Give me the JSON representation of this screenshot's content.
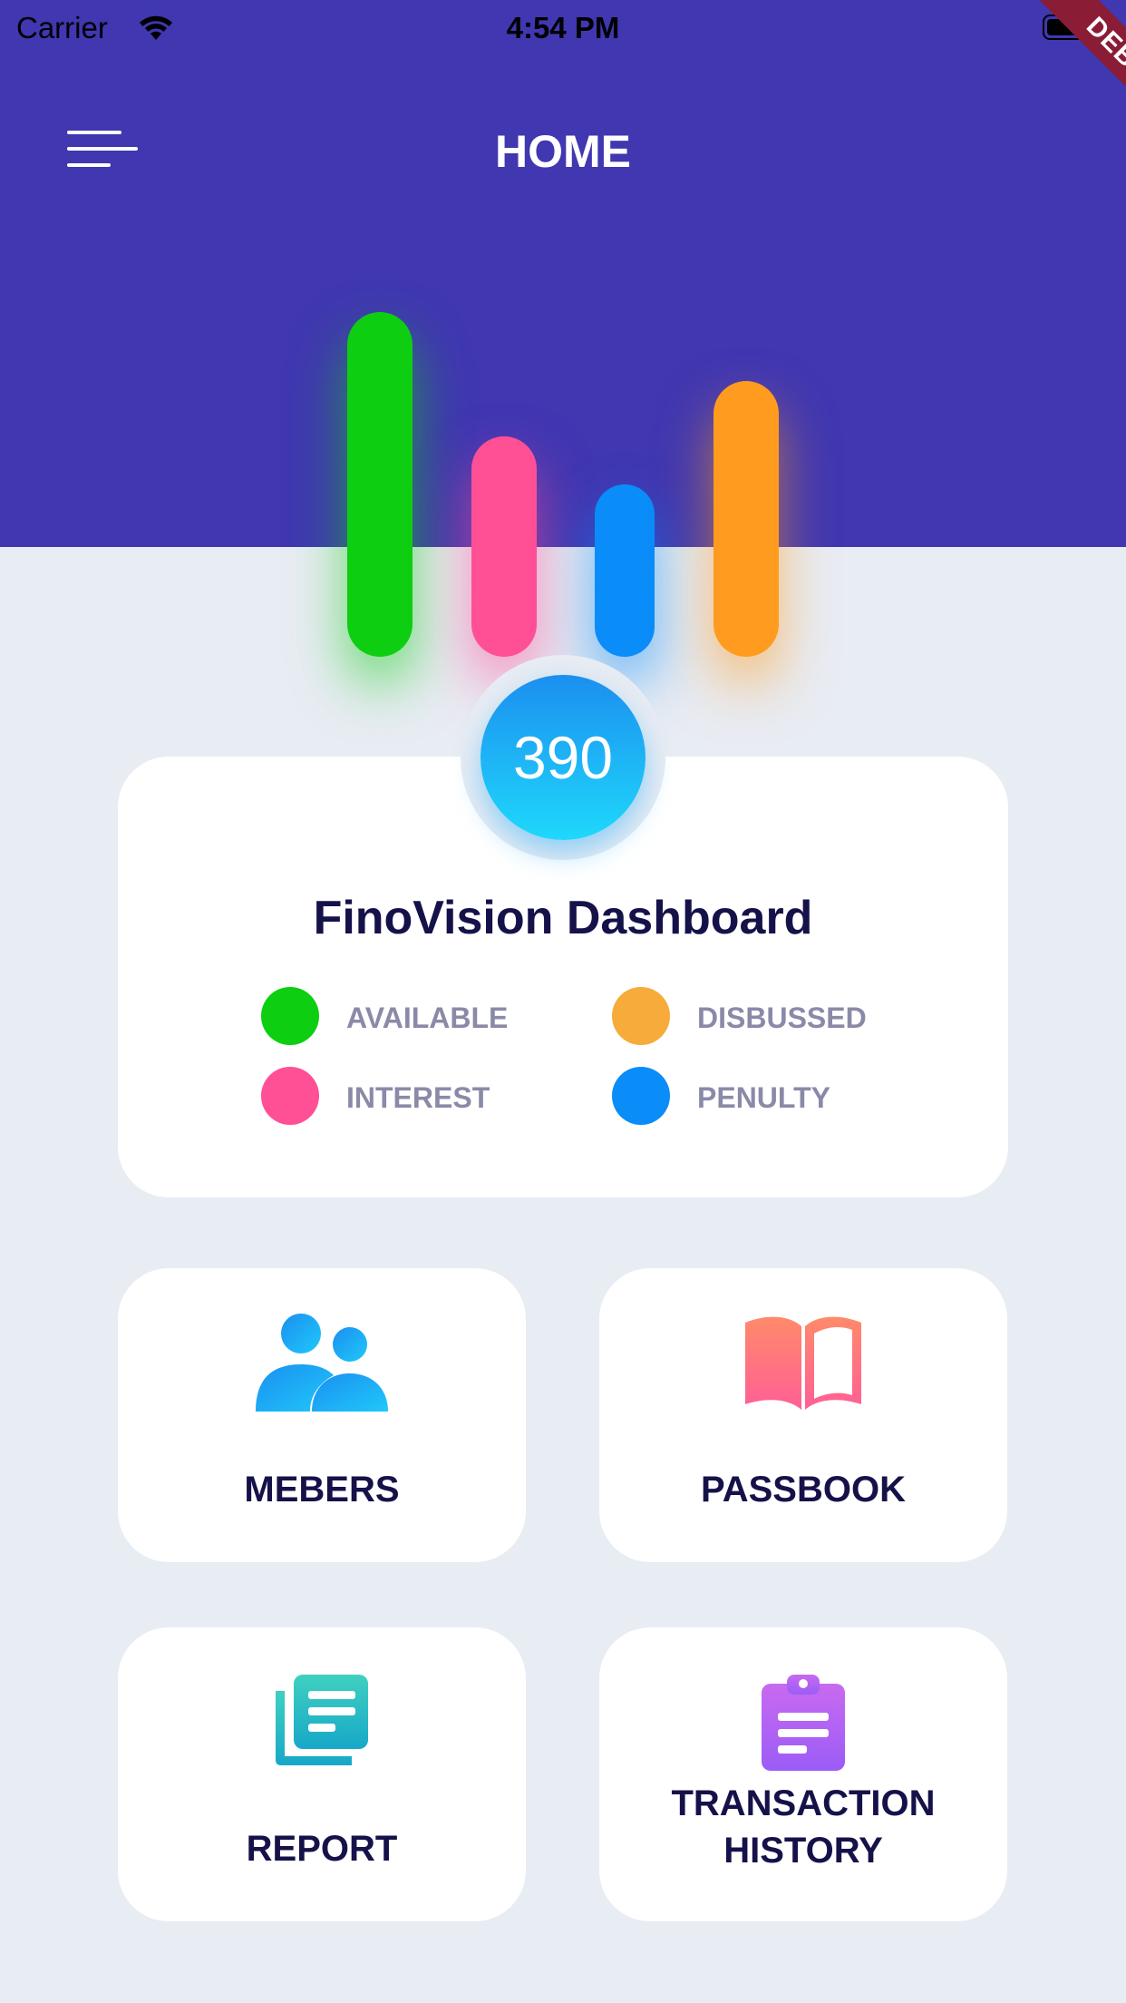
{
  "status_bar": {
    "carrier": "Carrier",
    "time": "4:54 PM",
    "icons": [
      "wifi-icon",
      "battery-icon"
    ]
  },
  "debug_banner": "DEBUG",
  "app_bar": {
    "title": "HOME",
    "menu_icon": "menu-icon"
  },
  "colors": {
    "header": "#4037b1",
    "background": "#e8ecf3",
    "available": "#0dce10",
    "interest": "#ff4f95",
    "penulty": "#0a8cf9",
    "disbussed": "#ff9b1e"
  },
  "chart_data": {
    "type": "bar",
    "categories": [
      "AVAILABLE",
      "INTEREST",
      "PENULTY",
      "DISBUSSED"
    ],
    "values": [
      1.0,
      0.64,
      0.5,
      0.8
    ]
  },
  "dashboard": {
    "count": "390",
    "title": "FinoVision Dashboard",
    "legend": [
      {
        "label": "AVAILABLE",
        "color": "#0dce10"
      },
      {
        "label": "DISBUSSED",
        "color": "#f7ab3a"
      },
      {
        "label": "INTEREST",
        "color": "#ff4f95"
      },
      {
        "label": "PENULTY",
        "color": "#0a8cf9"
      }
    ]
  },
  "tiles": [
    {
      "label": "MEBERS",
      "icon": "members-icon"
    },
    {
      "label": "PASSBOOK",
      "icon": "passbook-icon"
    },
    {
      "label": "REPORT",
      "icon": "report-icon"
    },
    {
      "label": "TRANSACTION HISTORY",
      "icon": "transaction-history-icon"
    }
  ]
}
